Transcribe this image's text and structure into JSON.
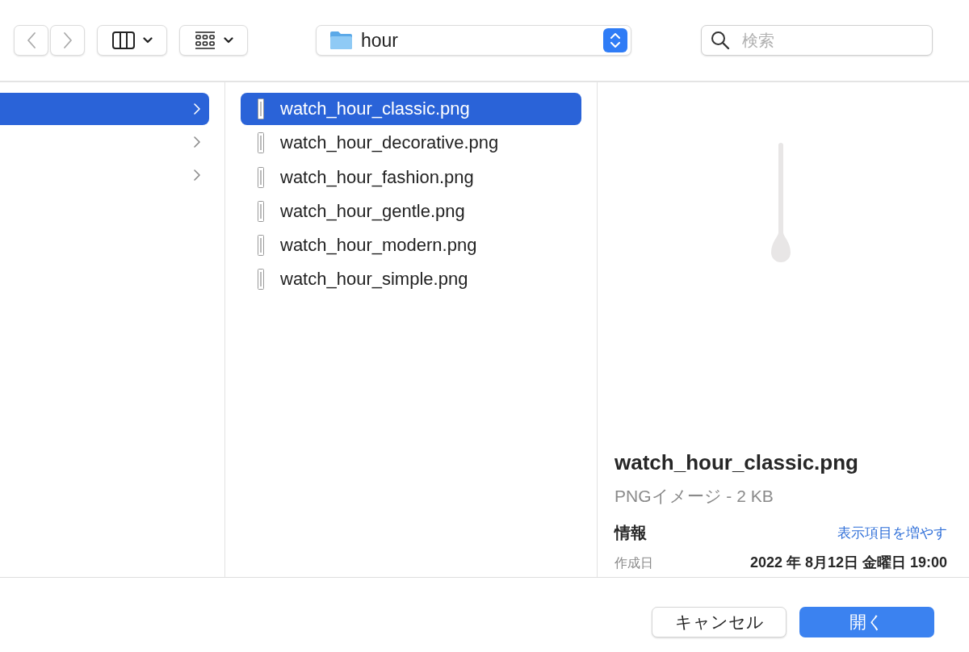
{
  "toolbar": {
    "path": {
      "label": "hour"
    },
    "search": {
      "placeholder": "検索"
    }
  },
  "left_column": {
    "items": [
      {
        "selected": true
      },
      {
        "selected": false
      },
      {
        "selected": false
      }
    ]
  },
  "files": [
    {
      "name": "watch_hour_classic.png",
      "selected": true
    },
    {
      "name": "watch_hour_decorative.png",
      "selected": false
    },
    {
      "name": "watch_hour_fashion.png",
      "selected": false
    },
    {
      "name": "watch_hour_gentle.png",
      "selected": false
    },
    {
      "name": "watch_hour_modern.png",
      "selected": false
    },
    {
      "name": "watch_hour_simple.png",
      "selected": false
    }
  ],
  "preview": {
    "name": "watch_hour_classic.png",
    "kind": "PNGイメージ - 2 KB",
    "info_heading": "情報",
    "more_link": "表示項目を増やす",
    "rows": [
      {
        "label": "作成日",
        "value": "2022 年 8月12日 金曜日 19:00"
      }
    ]
  },
  "buttons": [
    {
      "label": "キャンセル",
      "kind": "secondary"
    },
    {
      "label": "開く",
      "kind": "primary"
    }
  ]
}
